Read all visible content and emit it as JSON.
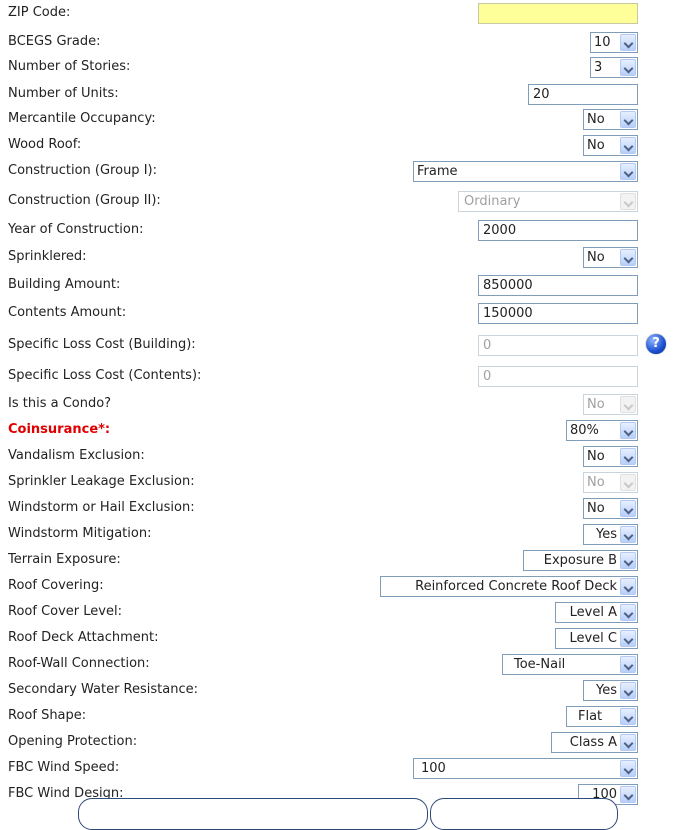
{
  "fields": [
    {
      "label": "ZIP Code:",
      "value": ""
    },
    {
      "label": "BCEGS Grade:",
      "value": "10"
    },
    {
      "label": "Number of Stories:",
      "value": "3"
    },
    {
      "label": "Number of Units:",
      "value": "20"
    },
    {
      "label": "Mercantile Occupancy:",
      "value": "No"
    },
    {
      "label": "Wood Roof:",
      "value": "No"
    },
    {
      "label": "Construction (Group I):",
      "value": "Frame"
    },
    {
      "label": "Construction (Group II):",
      "value": "Ordinary"
    },
    {
      "label": "Year of Construction:",
      "value": "2000"
    },
    {
      "label": "Sprinklered:",
      "value": "No"
    },
    {
      "label": "Building Amount:",
      "value": "850000"
    },
    {
      "label": "Contents Amount:",
      "value": "150000"
    },
    {
      "label": "Specific Loss Cost (Building):",
      "value": "0"
    },
    {
      "label": "Specific Loss Cost (Contents):",
      "value": "0"
    },
    {
      "label": "Is this a Condo?",
      "value": "No"
    },
    {
      "label": "Coinsurance*:",
      "value": "80%"
    },
    {
      "label": "Vandalism Exclusion:",
      "value": "No"
    },
    {
      "label": "Sprinkler Leakage Exclusion:",
      "value": "No"
    },
    {
      "label": "Windstorm or Hail Exclusion:",
      "value": "No"
    },
    {
      "label": "Windstorm Mitigation:",
      "value": "Yes"
    },
    {
      "label": "Terrain Exposure:",
      "value": "Exposure B"
    },
    {
      "label": "Roof Covering:",
      "value": "Reinforced Concrete Roof Deck"
    },
    {
      "label": "Roof Cover Level:",
      "value": "Level A"
    },
    {
      "label": "Roof Deck Attachment:",
      "value": "Level C"
    },
    {
      "label": "Roof-Wall Connection:",
      "value": "Toe-Nail"
    },
    {
      "label": "Secondary Water Resistance:",
      "value": "Yes"
    },
    {
      "label": "Roof Shape:",
      "value": "Flat"
    },
    {
      "label": "Opening Protection:",
      "value": "Class A"
    },
    {
      "label": "FBC Wind Speed:",
      "value": "100"
    },
    {
      "label": "FBC Wind Design:",
      "value": "100"
    }
  ],
  "help_icon": "question-mark-icon",
  "colors": {
    "required_label": "#e00000",
    "zip_input_bg": "#ffff99",
    "border": "#7f9db9",
    "help_icon": "#1a4fd0"
  }
}
